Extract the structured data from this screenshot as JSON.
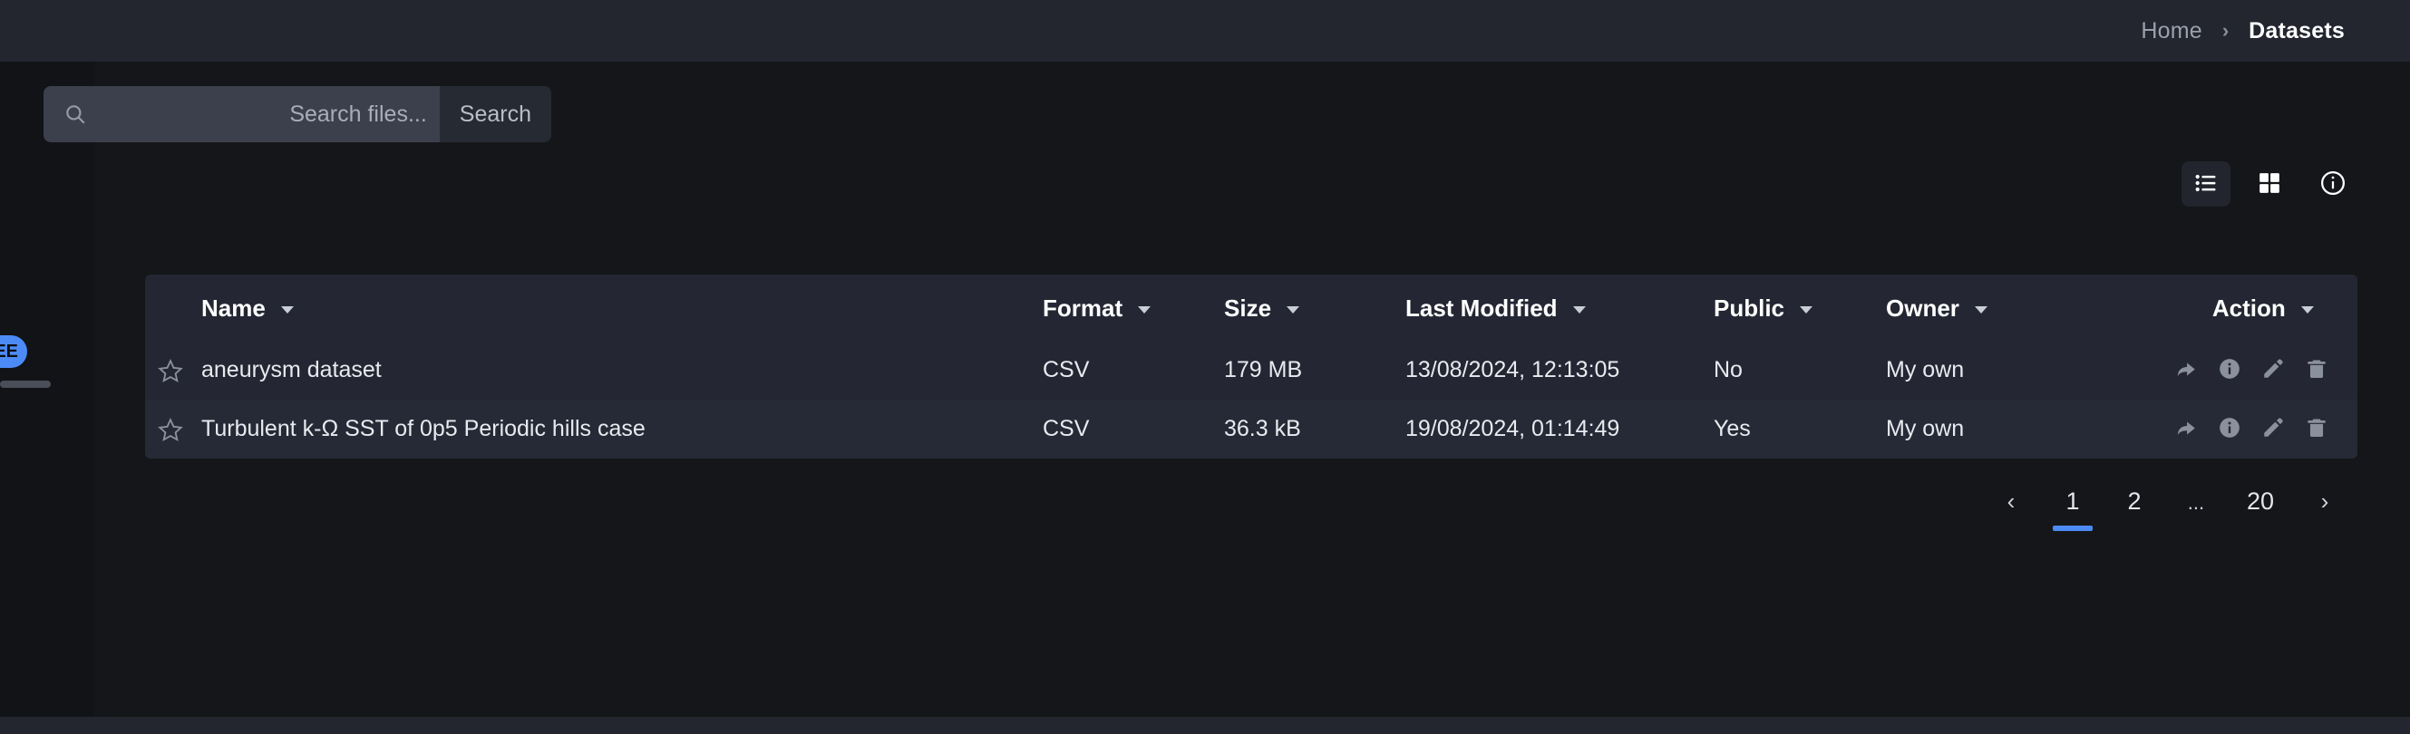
{
  "breadcrumb": {
    "home": "Home",
    "separator": "›",
    "current": "Datasets"
  },
  "search": {
    "placeholder": "Search files...",
    "value": "",
    "button_label": "Search"
  },
  "view_toggles": {
    "list_label": "List view",
    "grid_label": "Grid view",
    "info_label": "Information"
  },
  "table": {
    "headers": {
      "name": "Name",
      "format": "Format",
      "size": "Size",
      "last_modified": "Last Modified",
      "public": "Public",
      "owner": "Owner",
      "action": "Action"
    },
    "rows": [
      {
        "name": "aneurysm dataset",
        "format": "CSV",
        "size": "179 MB",
        "last_modified": "13/08/2024, 12:13:05",
        "public": "No",
        "owner": "My own"
      },
      {
        "name": "Turbulent k-Ω SST of 0p5 Periodic hills case",
        "format": "CSV",
        "size": "36.3 kB",
        "last_modified": "19/08/2024, 01:14:49",
        "public": "Yes",
        "owner": "My own"
      }
    ]
  },
  "pagination": {
    "prev": "‹",
    "next": "›",
    "pages": [
      "1",
      "2",
      "...",
      "20"
    ],
    "current": "1"
  },
  "sidebar": {
    "edition_badge": "EE"
  },
  "colors": {
    "accent": "#4c8bf5",
    "topbar_bg": "#23262f",
    "content_bg": "#151619",
    "table_bg": "#242733",
    "search_bg": "#3c404c"
  }
}
